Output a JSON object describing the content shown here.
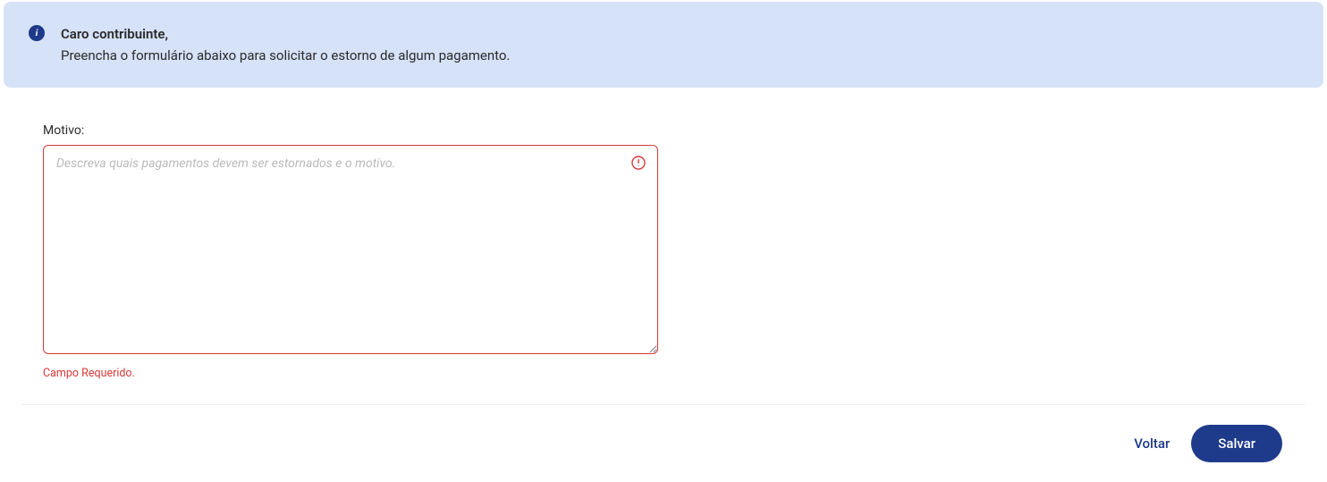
{
  "alert": {
    "title": "Caro contribuinte,",
    "body": "Preencha o formulário abaixo para solicitar o estorno de algum pagamento."
  },
  "form": {
    "motivo": {
      "label": "Motivo:",
      "placeholder": "Descreva quais pagamentos devem ser estornados e o motivo.",
      "value": "",
      "error": "Campo Requerido."
    }
  },
  "actions": {
    "back": "Voltar",
    "save": "Salvar"
  }
}
